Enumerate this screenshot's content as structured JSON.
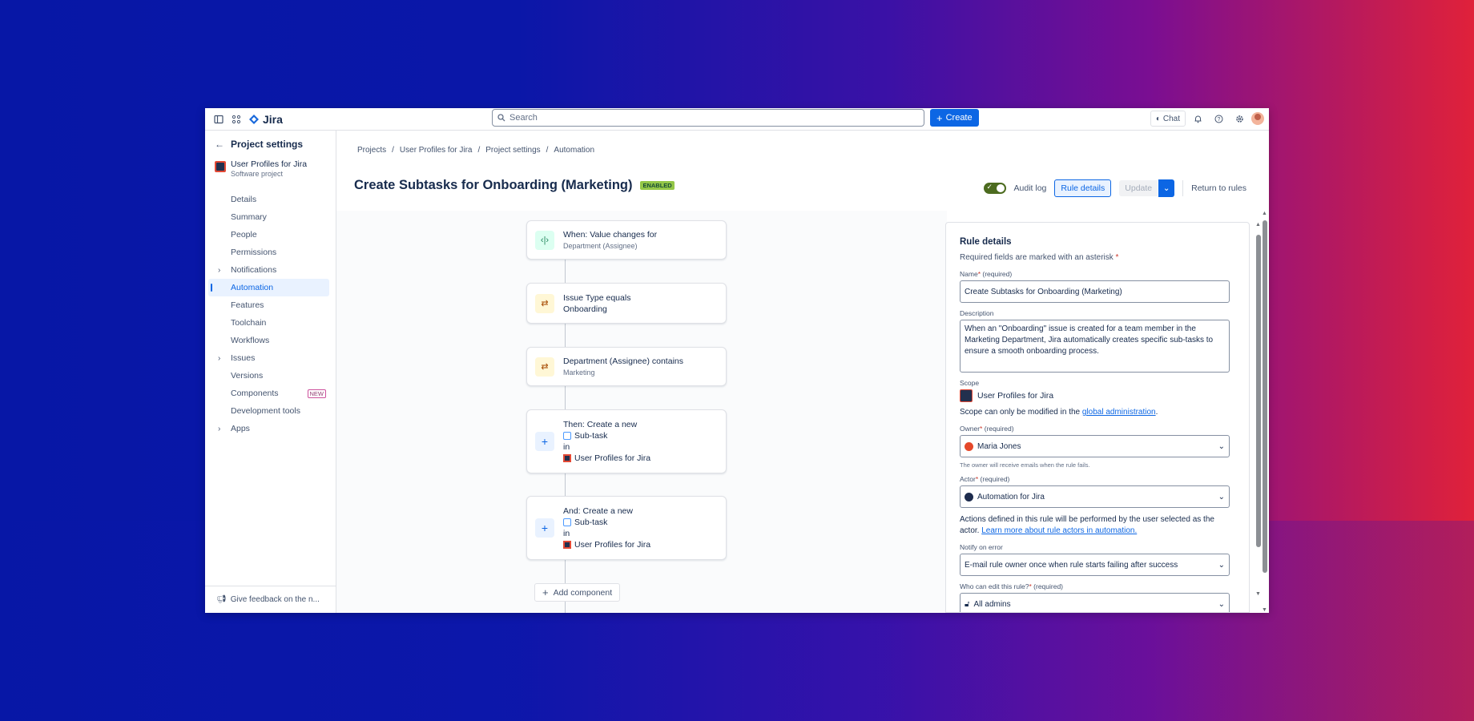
{
  "nav": {
    "app_name": "Jira",
    "search_placeholder": "Search",
    "create_label": "Create",
    "chat_label": "Chat"
  },
  "sidebar": {
    "back_title": "Project settings",
    "project_name": "User Profiles for Jira",
    "project_type": "Software project",
    "items": [
      {
        "label": "Details"
      },
      {
        "label": "Summary"
      },
      {
        "label": "People"
      },
      {
        "label": "Permissions"
      },
      {
        "label": "Notifications"
      },
      {
        "label": "Automation"
      },
      {
        "label": "Features"
      },
      {
        "label": "Toolchain"
      },
      {
        "label": "Workflows"
      },
      {
        "label": "Issues"
      },
      {
        "label": "Versions"
      },
      {
        "label": "Components",
        "badge": "NEW"
      },
      {
        "label": "Development tools"
      },
      {
        "label": "Apps"
      }
    ],
    "feedback": "Give feedback on the n..."
  },
  "breadcrumb": [
    "Projects",
    "User Profiles for Jira",
    "Project settings",
    "Automation"
  ],
  "page": {
    "title": "Create Subtasks for Onboarding (Marketing)",
    "status": "ENABLED",
    "audit_log": "Audit log",
    "rule_details": "Rule details",
    "update": "Update",
    "return": "Return to rules"
  },
  "flow": {
    "trigger": {
      "title": "When: Value changes for",
      "sub": "Department (Assignee)"
    },
    "cond1": {
      "title": "Issue Type equals",
      "value": "Onboarding"
    },
    "cond2": {
      "title": "Department (Assignee) contains",
      "sub": "Marketing"
    },
    "action1": {
      "title": "Then: Create a new",
      "type": "Sub-task",
      "in": "in",
      "project": "User Profiles for Jira"
    },
    "action2": {
      "title": "And: Create a new",
      "type": "Sub-task",
      "in": "in",
      "project": "User Profiles for Jira"
    },
    "add_component": "Add component"
  },
  "details": {
    "heading": "Rule details",
    "note": "Required fields are marked with an asterisk",
    "name_label": "Name",
    "required": "(required)",
    "name_value": "Create Subtasks for Onboarding (Marketing)",
    "description_label": "Description",
    "description_value": "When an \"Onboarding\" issue is created for a team member in the Marketing Department, Jira automatically creates specific sub-tasks to ensure a smooth onboarding process.",
    "scope_label": "Scope",
    "scope_value": "User Profiles for Jira",
    "scope_note": "Scope can only be modified in the",
    "scope_link": "global administration",
    "owner_label": "Owner",
    "owner_value": "Maria Jones",
    "owner_help": "The owner will receive emails when the rule fails.",
    "actor_label": "Actor",
    "actor_value": "Automation for Jira",
    "actor_note": "Actions defined in this rule will be performed by the user selected as the actor.",
    "actor_link": "Learn more about rule actors in automation.",
    "notify_label": "Notify on error",
    "notify_value": "E-mail rule owner once when rule starts failing after success",
    "edit_label": "Who can edit this rule?",
    "edit_value": "All admins"
  }
}
